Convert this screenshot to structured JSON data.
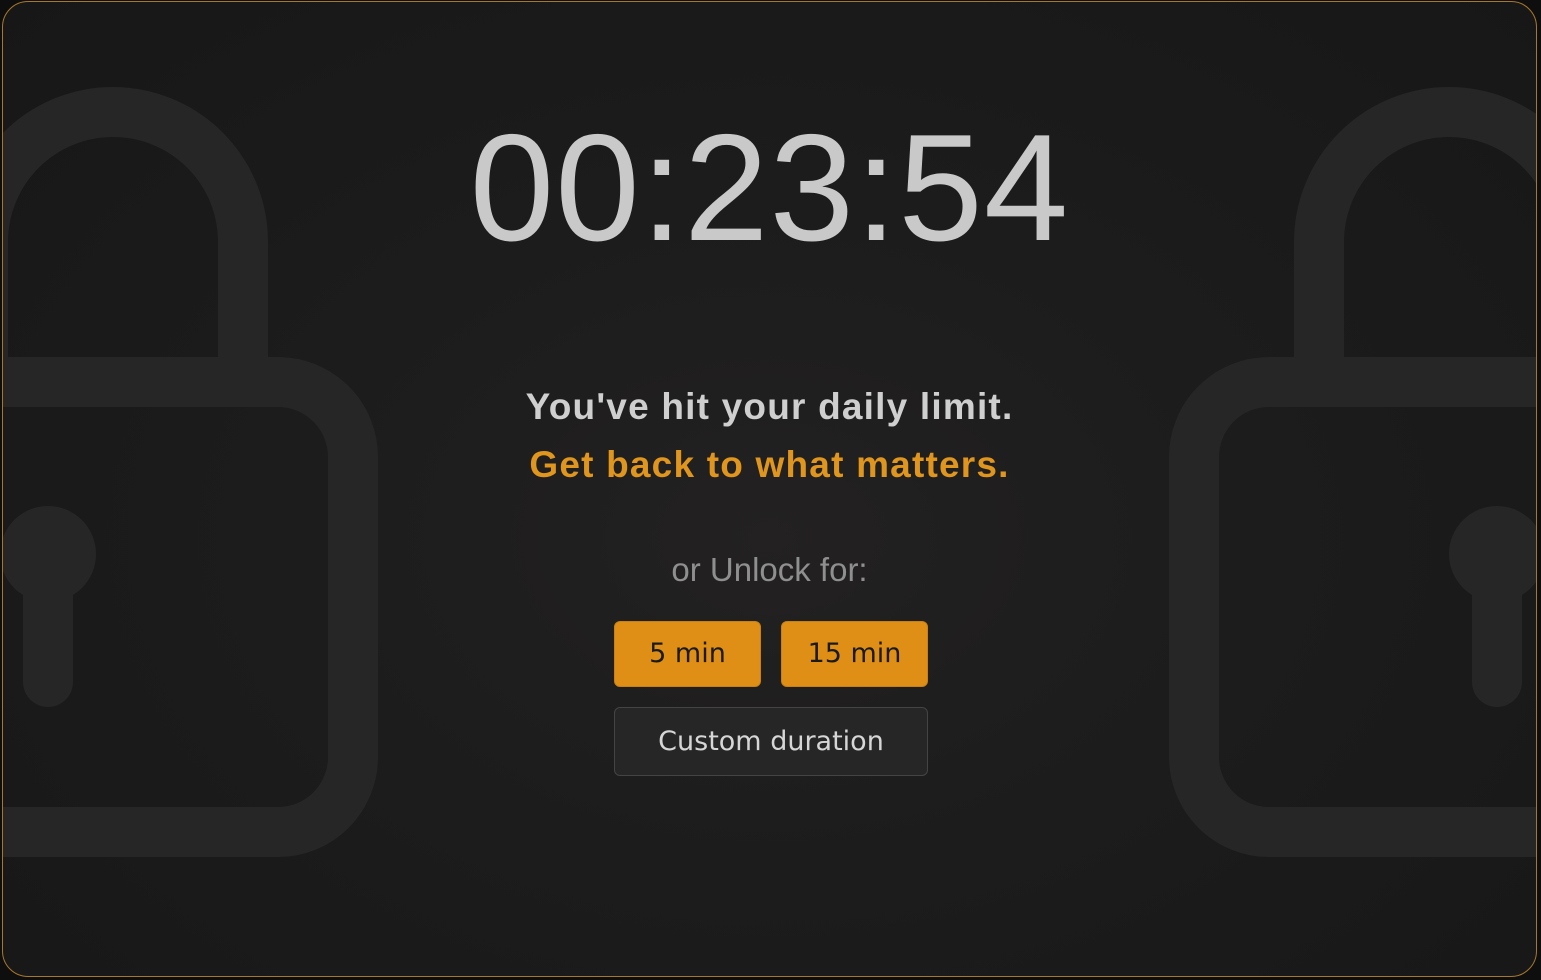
{
  "timer": {
    "display": "00:23:54"
  },
  "message": {
    "line1": "You've hit your daily limit.",
    "line2": "Get back to what matters."
  },
  "unlock": {
    "label": "or Unlock for:",
    "options": [
      {
        "label": "5 min"
      },
      {
        "label": "15 min"
      }
    ],
    "custom_label": "Custom duration"
  },
  "icons": {
    "background_left": "padlock-icon",
    "background_right": "padlock-icon"
  },
  "colors": {
    "accent": "#df8f16",
    "accent_text": "#e0951d",
    "timer_text": "#c9c9c9",
    "frame_border": "#a8782a",
    "background": "#1c1c1c"
  }
}
